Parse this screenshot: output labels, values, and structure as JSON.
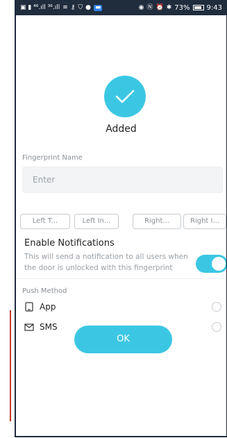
{
  "statusbar": {
    "left_text": "✉ Ω ⁴ᴳ.░ ³ᴳ.░",
    "battery_percent": "73%",
    "time": "9:43"
  },
  "result": {
    "text": "Added"
  },
  "fingerprint_name": {
    "label": "Fingerprint Name",
    "placeholder": "Enter"
  },
  "finger_chips": [
    "Left T...",
    "Left In...",
    "Right...",
    "Right I..."
  ],
  "notifications": {
    "title": "Enable Notifications",
    "description": "This will send a notification to all users when the door is unlocked with this fingerprint",
    "enabled": true
  },
  "push_method": {
    "label": "Push Method",
    "options": [
      {
        "label": "App",
        "icon": "tablet-icon",
        "selected": false
      },
      {
        "label": "SMS",
        "icon": "envelope-icon",
        "selected": false
      }
    ]
  },
  "ok_button": {
    "label": "OK"
  },
  "colors": {
    "accent": "#3bc7e3",
    "statusbar": "#1f2d3d"
  }
}
